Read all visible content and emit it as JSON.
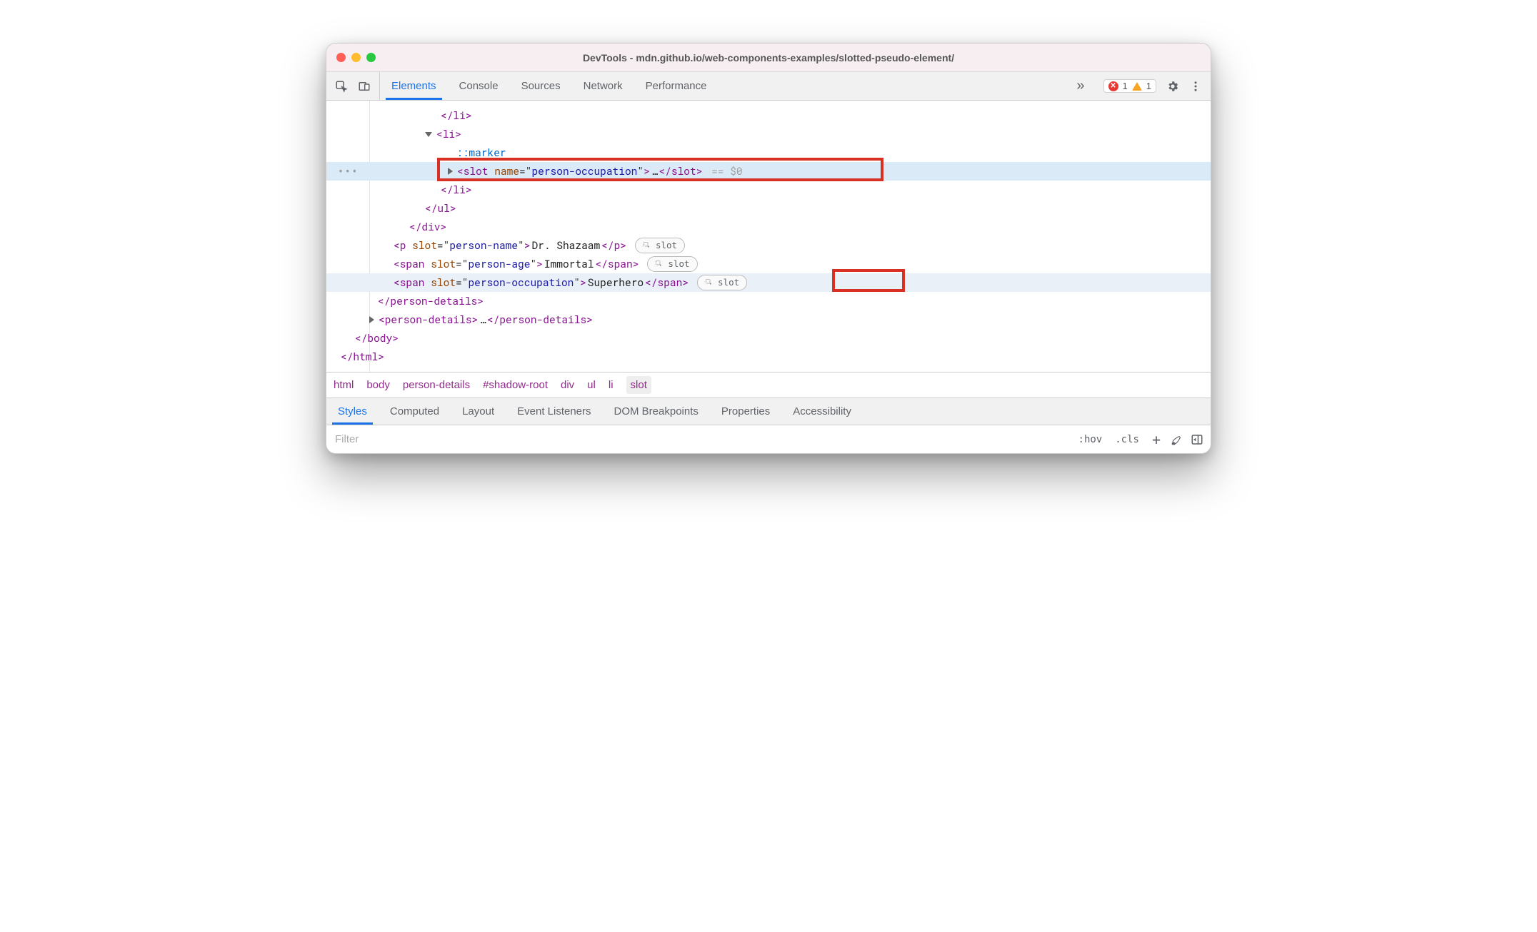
{
  "window": {
    "title": "DevTools - mdn.github.io/web-components-examples/slotted-pseudo-element/"
  },
  "toolbar": {
    "tabs": [
      "Elements",
      "Console",
      "Sources",
      "Network",
      "Performance"
    ],
    "active_tab": "Elements",
    "errors": "1",
    "warnings": "1"
  },
  "elements": {
    "lines": [
      {
        "indent": 150,
        "html": "<span class='tag'><span class='punct'>&lt;/</span><span class='name'>li</span><span class='punct'>&gt;</span></span>"
      },
      {
        "indent": 128,
        "html": "<span class='tri down'></span><span class='tag'><span class='punct'>&lt;</span><span class='name'>li</span><span class='punct'>&gt;</span></span>"
      },
      {
        "indent": 172,
        "html": "<span class='pseudo'>::marker</span>"
      },
      {
        "selected": true,
        "indent": 160,
        "html": "<span class='tri right'></span><span class='tag'><span class='punct'>&lt;</span><span class='name'>slot</span> <span class='attr-n'>name</span>=\"<span class='attr-v'>person-occupation</span>\"<span class='punct'>&gt;</span></span>…<span class='tag'><span class='punct'>&lt;/</span><span class='name'>slot</span><span class='punct'>&gt;</span></span>&nbsp;<span class='ghost'>== $0</span>",
        "gutter": "•••"
      },
      {
        "indent": 150,
        "html": "<span class='tag'><span class='punct'>&lt;/</span><span class='name'>li</span><span class='punct'>&gt;</span></span>"
      },
      {
        "indent": 128,
        "html": "<span class='tag'><span class='punct'>&lt;/</span><span class='name'>ul</span><span class='punct'>&gt;</span></span>"
      },
      {
        "indent": 106,
        "html": "<span class='tag'><span class='punct'>&lt;/</span><span class='name'>div</span><span class='punct'>&gt;</span></span>"
      },
      {
        "indent": 84,
        "html": "<span class='tag'><span class='punct'>&lt;</span><span class='name'>p</span> <span class='attr-n'>slot</span>=\"<span class='attr-v'>person-name</span>\"<span class='punct'>&gt;</span></span><span class='text'>Dr. Shazaam</span><span class='tag'><span class='punct'>&lt;/</span><span class='name'>p</span><span class='punct'>&gt;</span></span>",
        "pill": "slot"
      },
      {
        "indent": 84,
        "html": "<span class='tag'><span class='punct'>&lt;</span><span class='name'>span</span> <span class='attr-n'>slot</span>=\"<span class='attr-v'>person-age</span>\"<span class='punct'>&gt;</span></span><span class='text'>Immortal</span><span class='tag'><span class='punct'>&lt;/</span><span class='name'>span</span><span class='punct'>&gt;</span></span>",
        "pill": "slot"
      },
      {
        "hovered": true,
        "indent": 84,
        "html": "<span class='tag'><span class='punct'>&lt;</span><span class='name'>span</span> <span class='attr-n'>slot</span>=\"<span class='attr-v'>person-occupation</span>\"<span class='punct'>&gt;</span></span><span class='text'>Superhero</span><span class='tag'><span class='punct'>&lt;/</span><span class='name'>span</span><span class='punct'>&gt;</span></span>",
        "pill": "slot"
      },
      {
        "indent": 62,
        "html": "<span class='tag'><span class='punct'>&lt;/</span><span class='name'>person-details</span><span class='punct'>&gt;</span></span>"
      },
      {
        "indent": 50,
        "html": "<span class='tri right'></span><span class='tag'><span class='punct'>&lt;</span><span class='name'>person-details</span><span class='punct'>&gt;</span></span>…<span class='tag'><span class='punct'>&lt;/</span><span class='name'>person-details</span><span class='punct'>&gt;</span></span>"
      },
      {
        "indent": 30,
        "html": "<span class='tag'><span class='punct'>&lt;/</span><span class='name'>body</span><span class='punct'>&gt;</span></span>"
      },
      {
        "indent": 10,
        "html": "<span class='tag'><span class='punct'>&lt;/</span><span class='name'>html</span><span class='punct'>&gt;</span></span>"
      }
    ]
  },
  "breadcrumb": {
    "items": [
      "html",
      "body",
      "person-details",
      "#shadow-root",
      "div",
      "ul",
      "li",
      "slot"
    ],
    "current": "slot"
  },
  "subtabs": {
    "items": [
      "Styles",
      "Computed",
      "Layout",
      "Event Listeners",
      "DOM Breakpoints",
      "Properties",
      "Accessibility"
    ],
    "active": "Styles"
  },
  "filter": {
    "placeholder": "Filter",
    "hov": ":hov",
    "cls": ".cls"
  }
}
